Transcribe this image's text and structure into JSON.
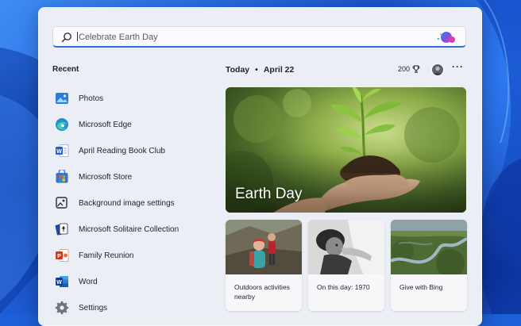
{
  "search": {
    "value": "Celebrate Earth Day",
    "icon": "search-icon",
    "bing_icon": "bing-chat-icon"
  },
  "recent": {
    "title": "Recent",
    "items": [
      {
        "label": "Photos",
        "icon": "photos-icon"
      },
      {
        "label": "Microsoft Edge",
        "icon": "edge-icon"
      },
      {
        "label": "April Reading Book Club",
        "icon": "word-doc-icon"
      },
      {
        "label": "Microsoft Store",
        "icon": "store-icon"
      },
      {
        "label": "Background image settings",
        "icon": "image-settings-icon"
      },
      {
        "label": "Microsoft Solitaire Collection",
        "icon": "solitaire-icon"
      },
      {
        "label": "Family Reunion",
        "icon": "powerpoint-icon"
      },
      {
        "label": "Word",
        "icon": "word-icon"
      },
      {
        "label": "Settings",
        "icon": "settings-icon"
      }
    ]
  },
  "today": {
    "label": "Today",
    "date": "April 22",
    "points": "200",
    "points_icon": "trophy-icon",
    "more": "···"
  },
  "hero": {
    "title": "Earth Day"
  },
  "cards": [
    {
      "caption": "Outdoors activities nearby"
    },
    {
      "caption": "On this day: 1970"
    },
    {
      "caption": "Give with Bing"
    }
  ],
  "colors": {
    "accent": "#2f6fd2",
    "panel_bg": "#eceef6"
  }
}
